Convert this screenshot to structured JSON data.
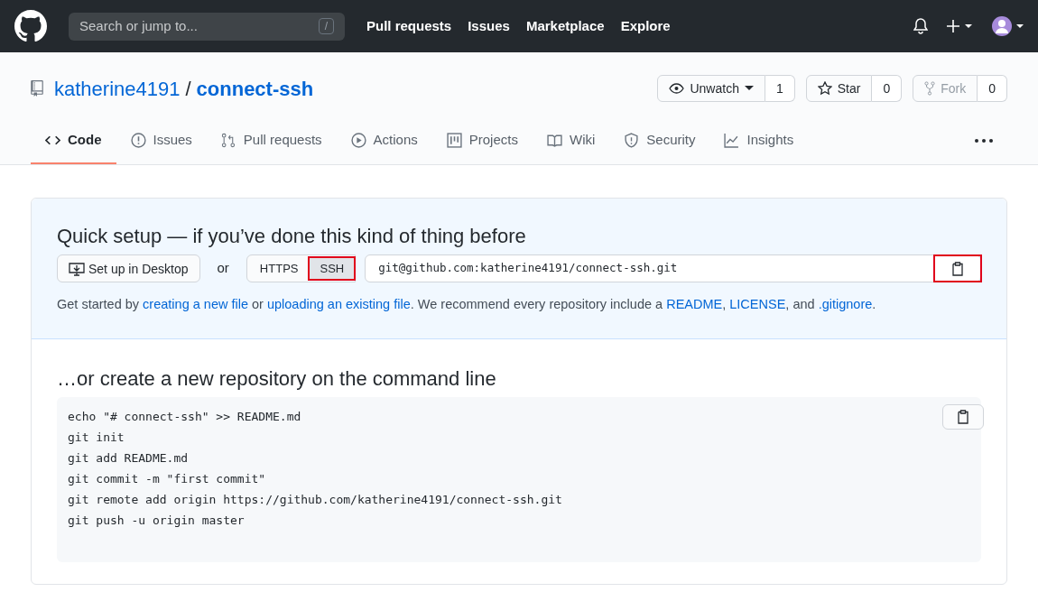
{
  "header": {
    "search_placeholder": "Search or jump to...",
    "search_key": "/",
    "nav": [
      "Pull requests",
      "Issues",
      "Marketplace",
      "Explore"
    ]
  },
  "repo": {
    "owner": "katherine4191",
    "separator": "/",
    "name": "connect-ssh",
    "actions": [
      {
        "kind": "watch",
        "label": "Unwatch",
        "count": "1",
        "disabled": false
      },
      {
        "kind": "star",
        "label": "Star",
        "count": "0",
        "disabled": false
      },
      {
        "kind": "fork",
        "label": "Fork",
        "count": "0",
        "disabled": true
      }
    ]
  },
  "tabs": [
    {
      "kind": "code",
      "label": "Code",
      "selected": true
    },
    {
      "kind": "issues",
      "label": "Issues",
      "selected": false
    },
    {
      "kind": "pulls",
      "label": "Pull requests",
      "selected": false
    },
    {
      "kind": "actions",
      "label": "Actions",
      "selected": false
    },
    {
      "kind": "projects",
      "label": "Projects",
      "selected": false
    },
    {
      "kind": "wiki",
      "label": "Wiki",
      "selected": false
    },
    {
      "kind": "security",
      "label": "Security",
      "selected": false
    },
    {
      "kind": "insights",
      "label": "Insights",
      "selected": false
    }
  ],
  "quick_setup": {
    "title": "Quick setup — if you’ve done this kind of thing before",
    "desktop_button": "Set up in Desktop",
    "or": "or",
    "protocols": [
      {
        "label": "HTTPS",
        "selected": false,
        "highlighted": false
      },
      {
        "label": "SSH",
        "selected": true,
        "highlighted": true
      }
    ],
    "url": "git@github.com:katherine4191/connect-ssh.git",
    "copy_highlighted": true,
    "help": [
      {
        "text": "Get started by ",
        "link": false
      },
      {
        "text": "creating a new file",
        "link": true
      },
      {
        "text": " or ",
        "link": false
      },
      {
        "text": "uploading an existing file",
        "link": true
      },
      {
        "text": ". We recommend every repository include a ",
        "link": false
      },
      {
        "text": "README",
        "link": true
      },
      {
        "text": ", ",
        "link": false
      },
      {
        "text": "LICENSE",
        "link": true
      },
      {
        "text": ", and ",
        "link": false
      },
      {
        "text": ".gitignore",
        "link": true
      },
      {
        "text": ".",
        "link": false
      }
    ]
  },
  "command_line": {
    "title": "…or create a new repository on the command line",
    "lines": [
      "echo \"# connect-ssh\" >> README.md",
      "git init",
      "git add README.md",
      "git commit -m \"first commit\"",
      "git remote add origin https://github.com/katherine4191/connect-ssh.git",
      "git push -u origin master"
    ]
  }
}
